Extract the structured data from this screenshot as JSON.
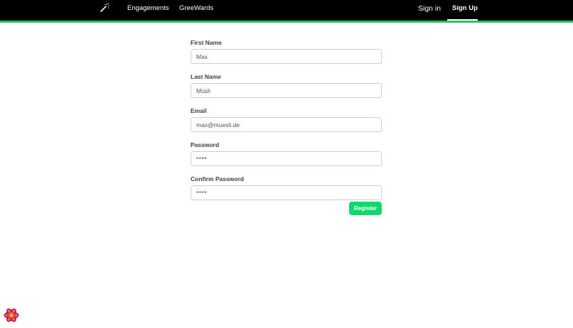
{
  "nav": {
    "logo_icon": "magic-wand-icon",
    "links": [
      "Engagements",
      "GreeWards"
    ],
    "sign_in": "Sign in",
    "sign_up": "Sign Up",
    "accent_color": "#22c55e"
  },
  "form": {
    "first_name": {
      "label": "First Name",
      "value": "Max"
    },
    "last_name": {
      "label": "Last Name",
      "value": "Müsli"
    },
    "email": {
      "label": "Email",
      "value": "max@muesli.de"
    },
    "password": {
      "label": "Password",
      "value": "****"
    },
    "confirm_password": {
      "label": "Confirm Password",
      "value": "****"
    },
    "register_label": "Register",
    "register_color": "#10d96b"
  },
  "devtools": {
    "icon": "react-query-devtools-icon"
  }
}
